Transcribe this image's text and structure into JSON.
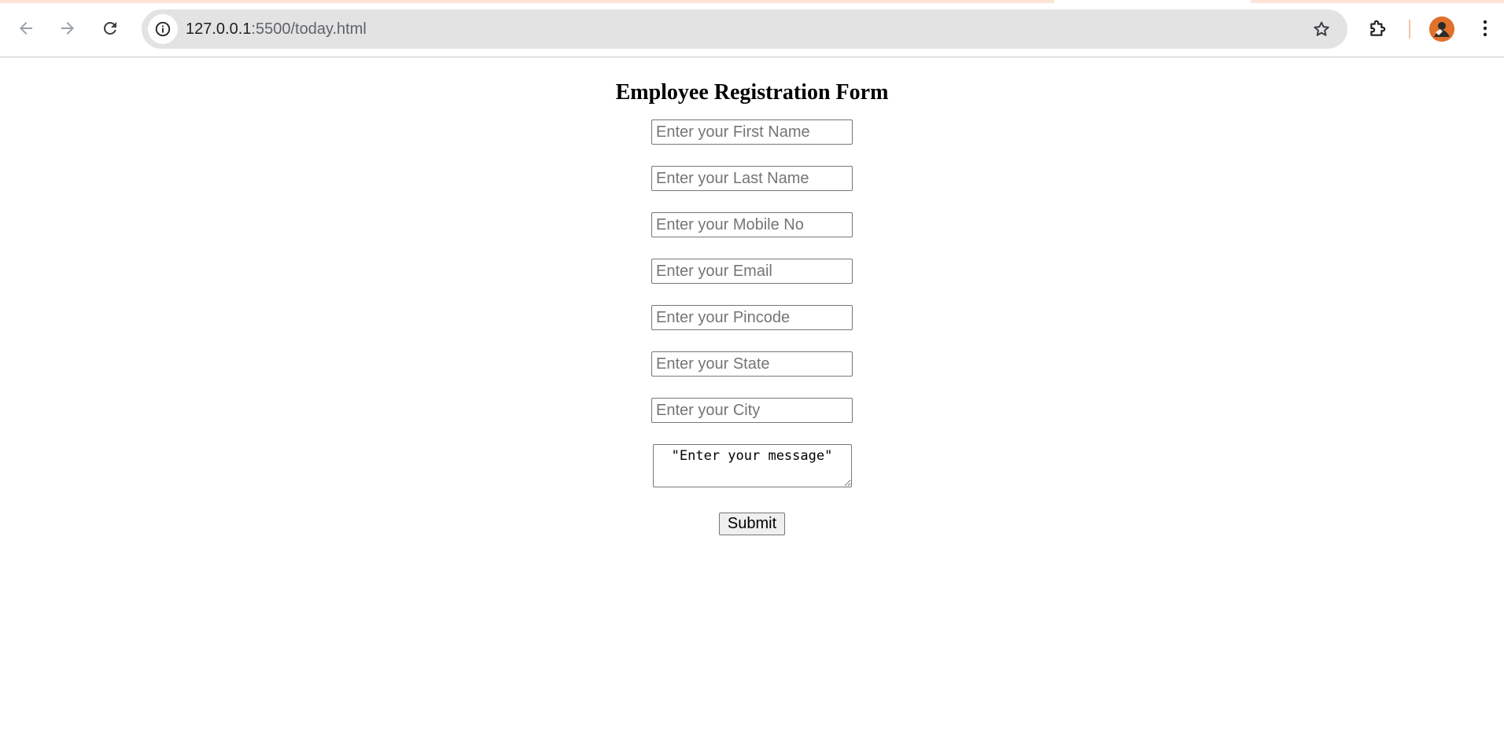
{
  "browser": {
    "url_host": "127.0.0.1",
    "url_rest": ":5500/today.html",
    "icons": {
      "back": "arrow-left-icon",
      "forward": "arrow-right-icon",
      "reload": "reload-icon",
      "site_info": "info-icon",
      "bookmark": "star-icon",
      "extensions": "puzzle-icon",
      "menu": "kebab-menu-icon"
    }
  },
  "form": {
    "title": "Employee Registration Form",
    "fields": {
      "first_name": "Enter your First Name",
      "last_name": "Enter your Last Name",
      "mobile": "Enter your Mobile No",
      "email": "Enter your Email",
      "pincode": "Enter your Pincode",
      "state": "Enter your State",
      "city": "Enter your City"
    },
    "message_value": "\"Enter your message\"",
    "submit_label": "Submit"
  },
  "colors": {
    "accent_strip": "#fde4d6",
    "omnibox": "#e3e3e3",
    "avatar": "#e0712b"
  }
}
